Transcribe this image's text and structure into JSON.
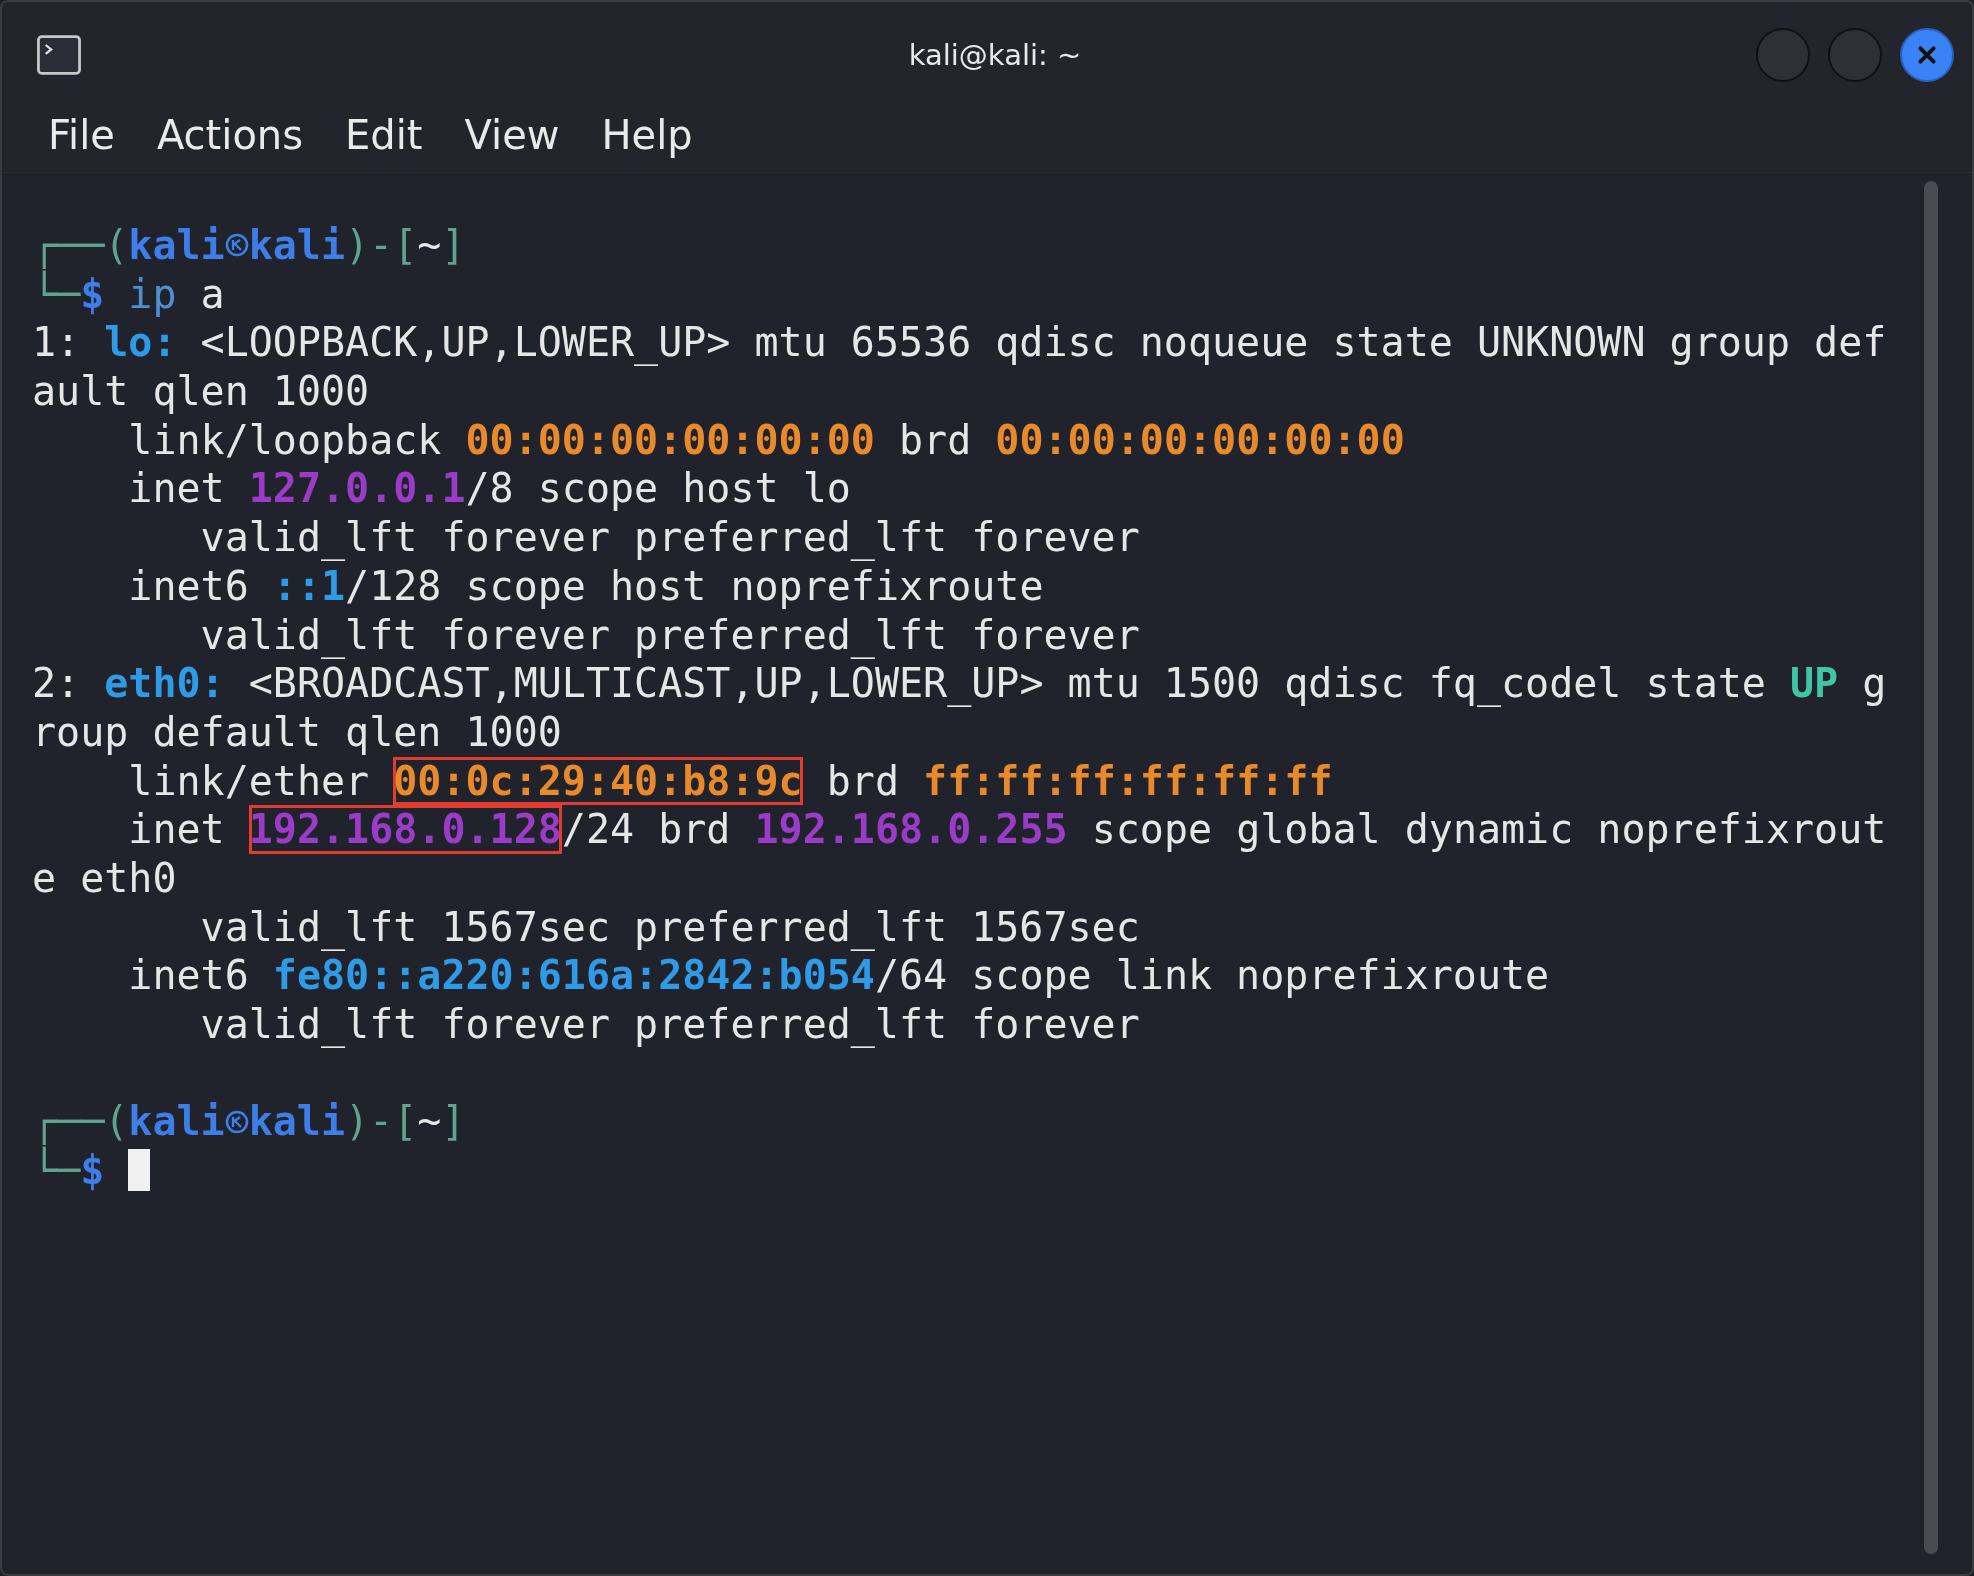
{
  "window": {
    "title": "kali@kali: ~"
  },
  "menu": [
    "File",
    "Actions",
    "Edit",
    "View",
    "Help"
  ],
  "blocks": [
    [
      [
        {
          "text": "┌──(",
          "kind": "frame"
        },
        {
          "text": "kali",
          "kind": "user"
        },
        {
          "kind": "symbol"
        },
        {
          "text": "kali",
          "kind": "user"
        },
        {
          "text": ")-[",
          "kind": "frame"
        },
        {
          "text": "~",
          "kind": "plain"
        },
        {
          "text": "]",
          "kind": "frame"
        }
      ],
      [
        {
          "text": "└─",
          "kind": "frame"
        },
        {
          "text": "$",
          "kind": "user"
        },
        {
          "text": " ip",
          "kind": "cmd"
        },
        {
          "text": " a",
          "kind": "plain"
        }
      ],
      [
        {
          "text": "1: ",
          "kind": "plain"
        },
        {
          "text": "lo:",
          "kind": "iface"
        },
        {
          "text": " <LOOPBACK,UP,LOWER_UP> mtu 65536 qdisc noqueue state UNKNOWN group def",
          "kind": "plain"
        }
      ],
      [
        {
          "text": "ault qlen 1000",
          "kind": "plain"
        }
      ],
      [
        {
          "text": "    link/loopback ",
          "kind": "plain"
        },
        {
          "text": "00:00:00:00:00:00",
          "kind": "mac"
        },
        {
          "text": " brd ",
          "kind": "plain"
        },
        {
          "text": "00:00:00:00:00:00",
          "kind": "mac"
        }
      ],
      [
        {
          "text": "    inet ",
          "kind": "plain"
        },
        {
          "text": "127.0.0.1",
          "kind": "ip"
        },
        {
          "text": "/8 scope host lo",
          "kind": "plain"
        }
      ],
      [
        {
          "text": "       valid_lft forever preferred_lft forever",
          "kind": "plain"
        }
      ],
      [
        {
          "text": "    inet6 ",
          "kind": "plain"
        },
        {
          "text": "::1",
          "kind": "iface"
        },
        {
          "text": "/128 scope host noprefixroute",
          "kind": "plain"
        }
      ],
      [
        {
          "text": "       valid_lft forever preferred_lft forever",
          "kind": "plain"
        }
      ],
      [
        {
          "text": "2: ",
          "kind": "plain"
        },
        {
          "text": "eth0:",
          "kind": "iface"
        },
        {
          "text": " <BROADCAST,MULTICAST,UP,LOWER_UP> mtu 1500 qdisc fq_codel state ",
          "kind": "plain"
        },
        {
          "text": "UP",
          "kind": "up"
        },
        {
          "text": " g",
          "kind": "plain"
        }
      ],
      [
        {
          "text": "roup default qlen 1000",
          "kind": "plain"
        }
      ],
      [
        {
          "text": "    link/ether ",
          "kind": "plain"
        },
        {
          "text": "00:0c:29:40:b8:9c",
          "kind": "mac-boxed"
        },
        {
          "text": " brd ",
          "kind": "plain"
        },
        {
          "text": "ff:ff:ff:ff:ff:ff",
          "kind": "mac"
        }
      ],
      [
        {
          "text": "    inet ",
          "kind": "plain"
        },
        {
          "text": "192.168.0.128",
          "kind": "ip-boxed"
        },
        {
          "text": "/24 brd ",
          "kind": "plain"
        },
        {
          "text": "192.168.0.255",
          "kind": "ip"
        },
        {
          "text": " scope global dynamic noprefixrout",
          "kind": "plain"
        }
      ],
      [
        {
          "text": "e eth0",
          "kind": "plain"
        }
      ],
      [
        {
          "text": "       valid_lft 1567sec preferred_lft 1567sec",
          "kind": "plain"
        }
      ],
      [
        {
          "text": "    inet6 ",
          "kind": "plain"
        },
        {
          "text": "fe80::a220:616a:2842:b054",
          "kind": "iface"
        },
        {
          "text": "/64 scope link noprefixroute",
          "kind": "plain"
        }
      ],
      [
        {
          "text": "       valid_lft forever preferred_lft forever",
          "kind": "plain"
        }
      ]
    ],
    [
      [
        {
          "text": "┌──(",
          "kind": "frame"
        },
        {
          "text": "kali",
          "kind": "user"
        },
        {
          "kind": "symbol"
        },
        {
          "text": "kali",
          "kind": "user"
        },
        {
          "text": ")-[",
          "kind": "frame"
        },
        {
          "text": "~",
          "kind": "plain"
        },
        {
          "text": "]",
          "kind": "frame"
        }
      ],
      [
        {
          "text": "└─",
          "kind": "frame"
        },
        {
          "text": "$",
          "kind": "user"
        },
        {
          "kind": "cursor"
        }
      ]
    ]
  ]
}
